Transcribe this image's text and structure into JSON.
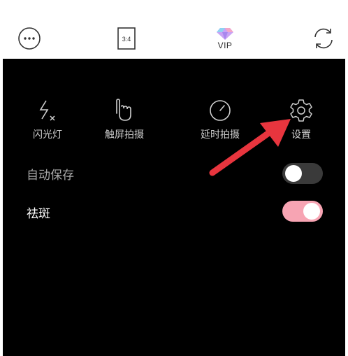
{
  "topbar": {
    "ratio_label": "3:4",
    "vip_label": "VIP"
  },
  "tools": {
    "flash": "闪光灯",
    "touch_shoot": "触屏拍摄",
    "timer_shoot": "延时拍摄",
    "settings": "设置"
  },
  "settings_rows": {
    "autosave_label": "自动保存",
    "autosave_on": false,
    "blemish_label": "祛斑",
    "blemish_on": true
  },
  "colors": {
    "panel_background": "#000000",
    "toggle_on": "#f7a4b3",
    "toggle_off": "#3a3a3a",
    "annotation_arrow": "#e8353e",
    "vip_gem": "#b98cf0"
  },
  "icons": {
    "more": "more-dots-icon",
    "ratio": "aspect-ratio-icon",
    "vip": "vip-diamond-icon",
    "switch_camera": "switch-camera-icon",
    "flash": "flash-off-icon",
    "touch": "touch-hand-icon",
    "timer": "timer-icon",
    "settings": "gear-icon"
  }
}
